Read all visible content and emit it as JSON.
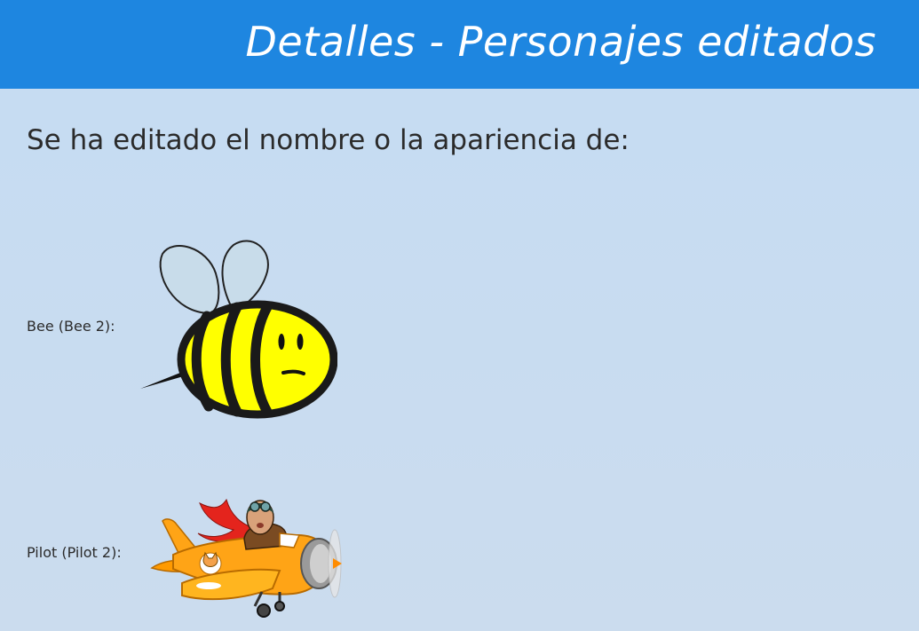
{
  "header": {
    "title": "Detalles - Personajes editados"
  },
  "main": {
    "intro": "Se ha editado el nombre o la apariencia de:",
    "characters": [
      {
        "label": "Bee (Bee 2):",
        "icon": "bee-sprite-icon"
      },
      {
        "label": "Pilot (Pilot 2):",
        "icon": "pilot-airplane-sprite-icon"
      }
    ]
  },
  "colors": {
    "header_bg": "#1e86e0",
    "page_bg": "#c5dcf3",
    "text": "#2b2b2b",
    "bee_yellow": "#ffff00",
    "plane_orange": "#ffa416"
  }
}
